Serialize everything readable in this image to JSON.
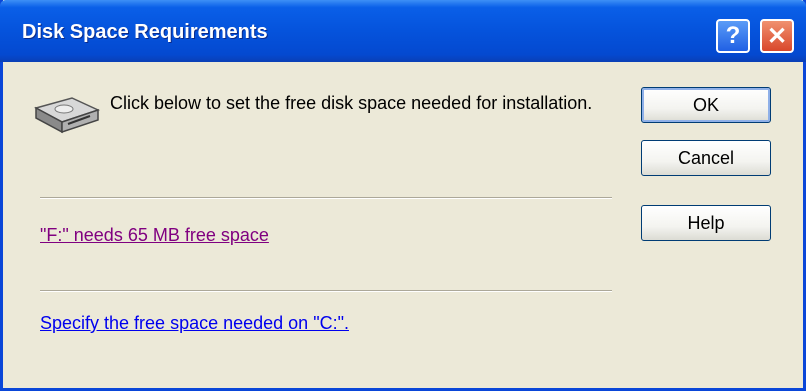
{
  "window": {
    "title": "Disk Space Requirements",
    "help_glyph": "?",
    "close_glyph": "✕"
  },
  "content": {
    "message": "Click below to set the free disk space needed for installation.",
    "icon": "hard-disk-icon",
    "link_drive": "\"F:\" needs 65 MB free space",
    "link_specify": "Specify the free space needed on \"C:\"."
  },
  "buttons": {
    "ok": "OK",
    "cancel": "Cancel",
    "help": "Help"
  },
  "colors": {
    "titlebar": "#0553dc",
    "visited_link": "#800080",
    "link": "#0000ee",
    "dialog_bg": "#ece9d8"
  }
}
